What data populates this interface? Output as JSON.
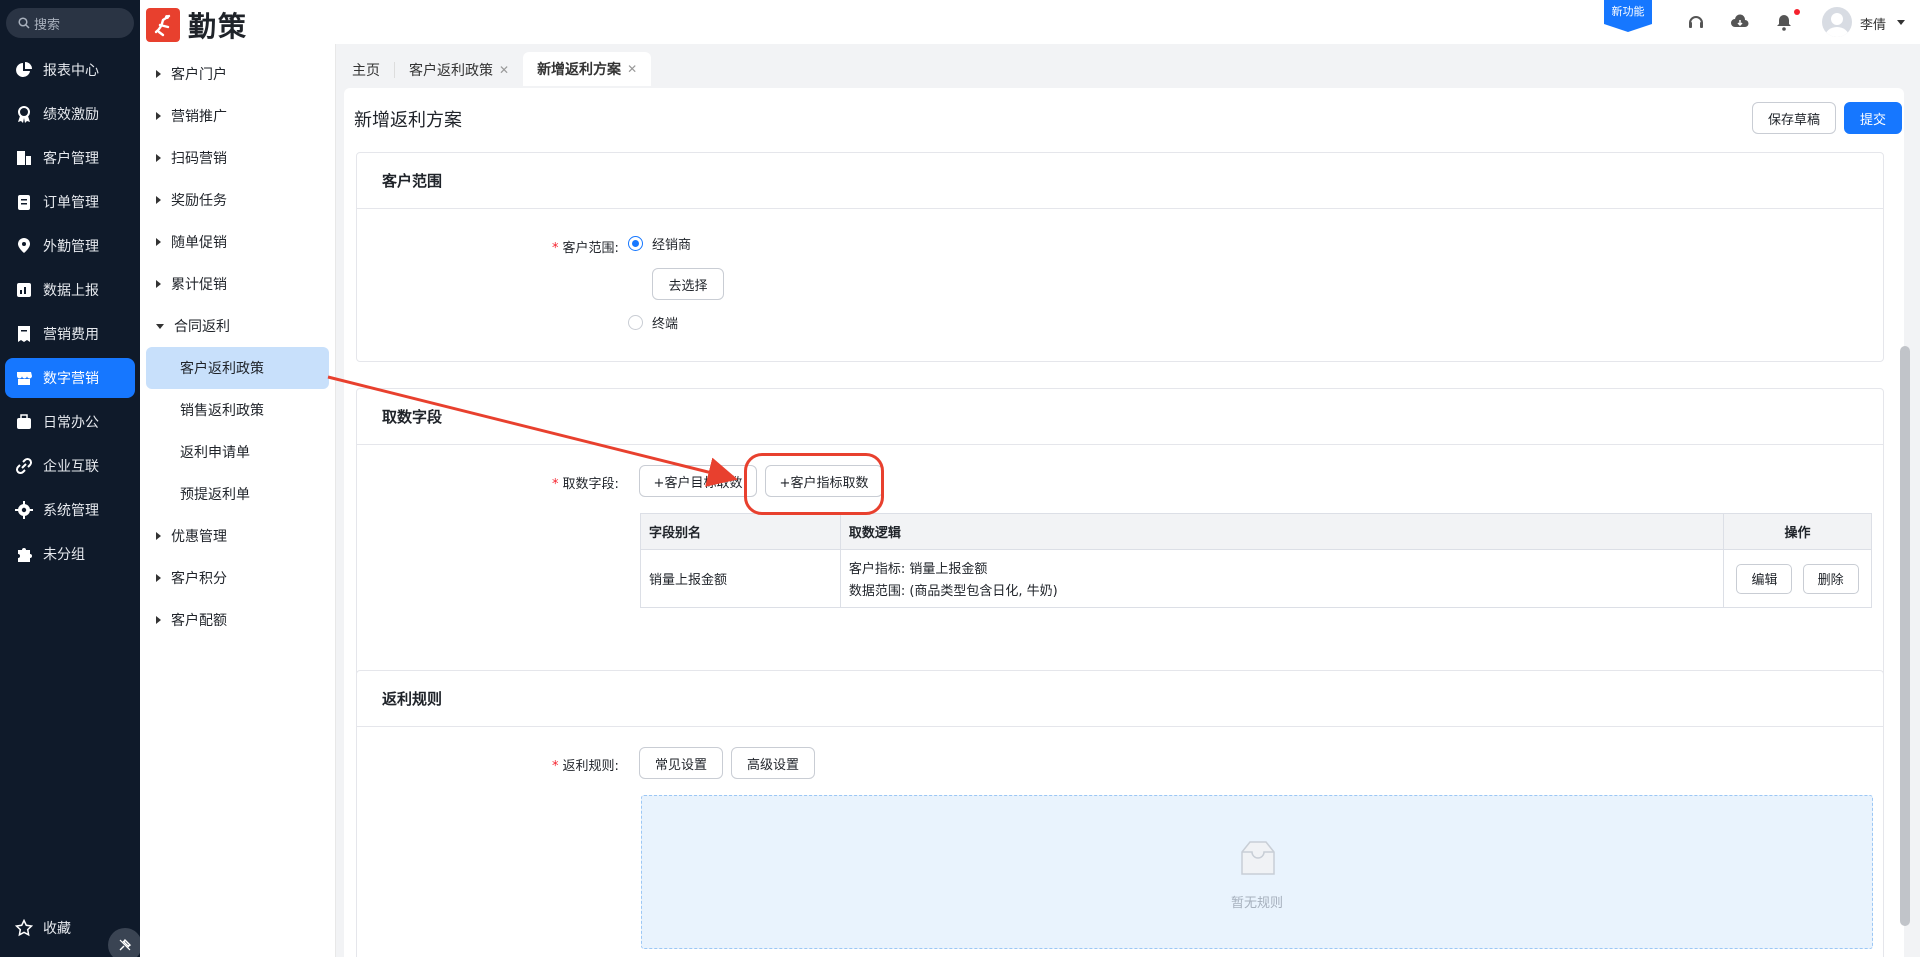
{
  "search": {
    "placeholder": "搜索"
  },
  "nav": [
    {
      "label": "报表中心",
      "icon": "pie-chart-icon"
    },
    {
      "label": "绩效激励",
      "icon": "medal-icon"
    },
    {
      "label": "客户管理",
      "icon": "building-icon"
    },
    {
      "label": "订单管理",
      "icon": "clipboard-icon"
    },
    {
      "label": "外勤管理",
      "icon": "location-icon"
    },
    {
      "label": "数据上报",
      "icon": "report-icon"
    },
    {
      "label": "营销费用",
      "icon": "bill-icon"
    },
    {
      "label": "数字营销",
      "icon": "store-icon",
      "active": true
    },
    {
      "label": "日常办公",
      "icon": "briefcase-icon"
    },
    {
      "label": "企业互联",
      "icon": "link-icon"
    },
    {
      "label": "系统管理",
      "icon": "gear-icon"
    },
    {
      "label": "未分组",
      "icon": "puzzle-icon"
    }
  ],
  "favorites": {
    "label": "收藏"
  },
  "header": {
    "logo_text": "勤策",
    "new_feature": "新功能",
    "user_name": "李倩"
  },
  "subnav": {
    "groups": [
      {
        "label": "客户门户"
      },
      {
        "label": "营销推广"
      },
      {
        "label": "扫码营销"
      },
      {
        "label": "奖励任务"
      },
      {
        "label": "随单促销"
      },
      {
        "label": "累计促销"
      },
      {
        "label": "合同返利",
        "expanded": true
      }
    ],
    "children": [
      {
        "label": "客户返利政策",
        "active": true
      },
      {
        "label": "销售返利政策"
      },
      {
        "label": "返利申请单"
      },
      {
        "label": "预提返利单"
      }
    ],
    "groups_after": [
      {
        "label": "优惠管理"
      },
      {
        "label": "客户积分"
      },
      {
        "label": "客户配额"
      }
    ]
  },
  "tabs": [
    {
      "label": "主页"
    },
    {
      "label": "客户返利政策",
      "closable": true
    },
    {
      "label": "新增返利方案",
      "closable": true,
      "active": true
    }
  ],
  "page": {
    "title": "新增返利方案",
    "save_draft": "保存草稿",
    "submit": "提交"
  },
  "customer_scope": {
    "section_title": "客户范围",
    "label": "客户范围:",
    "option_dealer": "经销商",
    "select_button": "去选择",
    "option_terminal": "终端",
    "selected": "经销商"
  },
  "data_fields": {
    "section_title": "取数字段",
    "label": "取数字段:",
    "add_target": "+客户目标取数",
    "add_indicator": "+客户指标取数",
    "columns": [
      "字段别名",
      "取数逻辑",
      "操作"
    ],
    "rows": [
      {
        "alias": "销量上报金额",
        "logic_line1": "客户指标: 销量上报金额",
        "logic_line2": "数据范围: (商品类型包含日化, 牛奶)",
        "edit": "编辑",
        "delete": "删除"
      }
    ]
  },
  "rebate_rules": {
    "section_title": "返利规则",
    "label": "返利规则:",
    "common_settings": "常见设置",
    "advanced_settings": "高级设置",
    "empty_text": "暂无规则"
  },
  "colors": {
    "primary": "#1677ff",
    "sidebar_bg": "#0f1a2a",
    "annotation": "#e8402e"
  }
}
